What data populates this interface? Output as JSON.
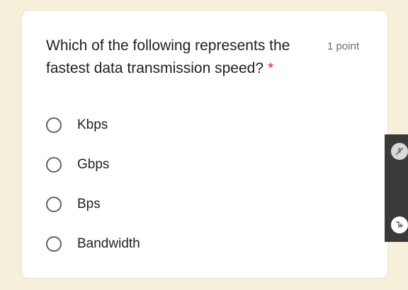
{
  "question": {
    "text": "Which of the following represents the fastest data transmission speed?",
    "required_mark": "*",
    "points": "1 point"
  },
  "options": [
    {
      "label": "Kbps"
    },
    {
      "label": "Gbps"
    },
    {
      "label": "Bps"
    },
    {
      "label": "Bandwidth"
    }
  ],
  "side_panel": {
    "icons": [
      "mic-off-icon",
      "add-note-icon"
    ]
  },
  "colors": {
    "background": "#f6efd9",
    "card": "#ffffff",
    "required": "#d93025",
    "radio_border": "#5f6368",
    "side_panel": "#3a3a3a"
  }
}
